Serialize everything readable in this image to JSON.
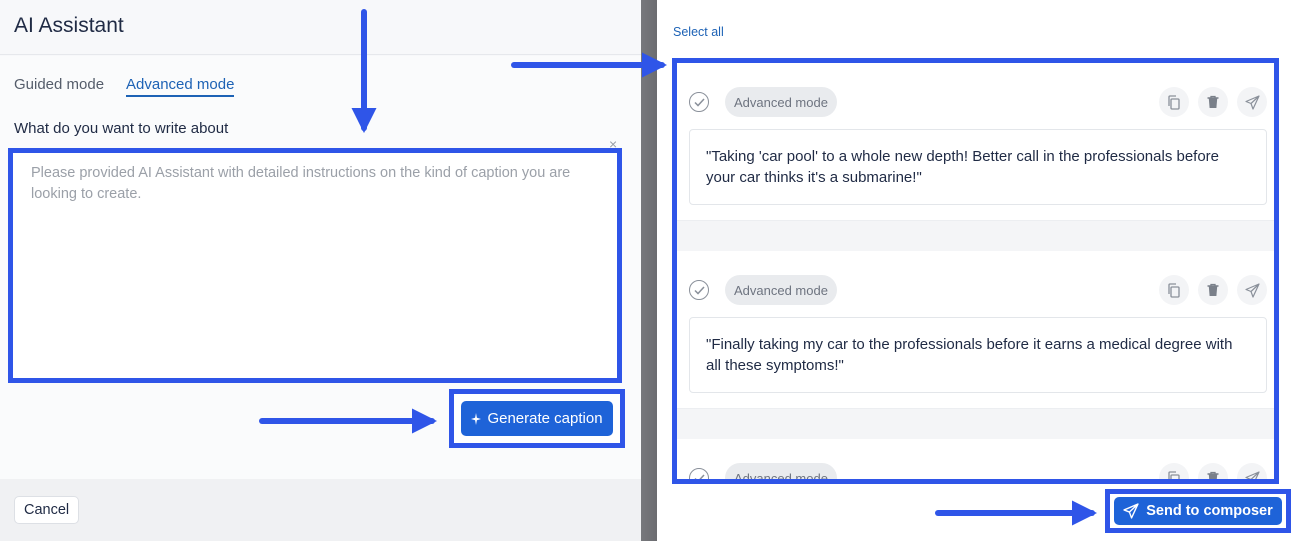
{
  "left": {
    "title": "AI Assistant",
    "tabs": [
      {
        "label": "Guided mode",
        "active": false
      },
      {
        "label": "Advanced mode",
        "active": true
      }
    ],
    "prompt_label": "What do you want to write about",
    "prompt_placeholder": "Please provided AI Assistant with detailed instructions on the kind of caption you are looking to create.",
    "prompt_value": "",
    "generate_label": "Generate caption",
    "cancel_label": "Cancel",
    "close_glyph": "×"
  },
  "right": {
    "select_all_label": "Select all",
    "cards": [
      {
        "mode": "Advanced mode",
        "caption": "\"Taking 'car pool' to a whole new depth! Better call in the professionals before your car thinks it's a submarine!\""
      },
      {
        "mode": "Advanced mode",
        "caption": "\"Finally taking my car to the professionals before it earns a medical degree with all these symptoms!\""
      },
      {
        "mode": "Advanced mode",
        "caption": ""
      }
    ],
    "send_label": "Send to composer"
  },
  "colors": {
    "accent": "#1e63d8",
    "annotation": "#2f55e8",
    "link": "#1d62b5"
  },
  "icons": [
    "check-circle-icon",
    "copy-icon",
    "trash-icon",
    "send-icon",
    "sparkle-icon"
  ]
}
